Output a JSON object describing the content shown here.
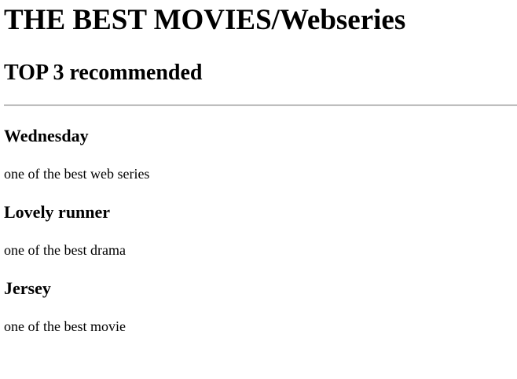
{
  "page": {
    "title": "THE BEST MOVIES/Webseries",
    "subtitle": "TOP 3 recommended"
  },
  "items": [
    {
      "title": "Wednesday",
      "description": "one of the best web series"
    },
    {
      "title": "Lovely runner",
      "description": "one of the best drama"
    },
    {
      "title": "Jersey",
      "description": "one of the best movie"
    }
  ]
}
